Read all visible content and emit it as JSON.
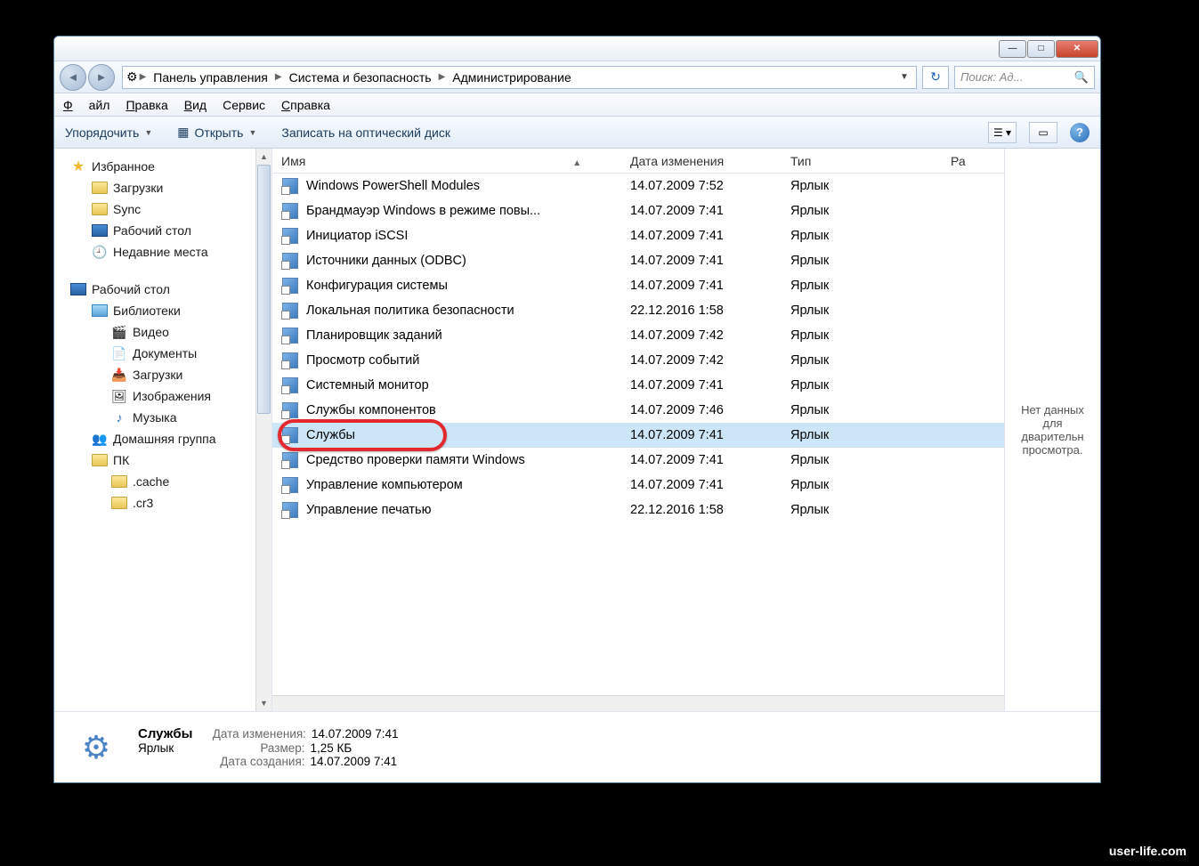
{
  "titlebar": {
    "min": "—",
    "max": "□",
    "close": "✕"
  },
  "breadcrumbs": [
    "Панель управления",
    "Система и безопасность",
    "Администрирование"
  ],
  "search_placeholder": "Поиск: Ад...",
  "menubar": {
    "file": "Файл",
    "edit": "Правка",
    "view": "Вид",
    "service": "Сервис",
    "help": "Справка"
  },
  "toolbar": {
    "organize": "Упорядочить",
    "open": "Открыть",
    "burn": "Записать на оптический диск"
  },
  "columns": {
    "name": "Имя",
    "date": "Дата изменения",
    "type": "Тип",
    "size": "Ра"
  },
  "sidebar": {
    "favorites": "Избранное",
    "fav_items": [
      "Загрузки",
      "Sync",
      "Рабочий стол",
      "Недавние места"
    ],
    "desktop": "Рабочий стол",
    "libraries": "Библиотеки",
    "lib_items": [
      "Видео",
      "Документы",
      "Загрузки",
      "Изображения",
      "Музыка"
    ],
    "homegroup": "Домашняя группа",
    "pc": "ПК",
    "pc_items": [
      ".cache",
      ".cr3"
    ]
  },
  "files": [
    {
      "name": "Windows PowerShell Modules",
      "date": "14.07.2009 7:52",
      "type": "Ярлык"
    },
    {
      "name": "Брандмауэр Windows в режиме повы...",
      "date": "14.07.2009 7:41",
      "type": "Ярлык"
    },
    {
      "name": "Инициатор iSCSI",
      "date": "14.07.2009 7:41",
      "type": "Ярлык"
    },
    {
      "name": "Источники данных (ODBC)",
      "date": "14.07.2009 7:41",
      "type": "Ярлык"
    },
    {
      "name": "Конфигурация системы",
      "date": "14.07.2009 7:41",
      "type": "Ярлык"
    },
    {
      "name": "Локальная политика безопасности",
      "date": "22.12.2016 1:58",
      "type": "Ярлык"
    },
    {
      "name": "Планировщик заданий",
      "date": "14.07.2009 7:42",
      "type": "Ярлык"
    },
    {
      "name": "Просмотр событий",
      "date": "14.07.2009 7:42",
      "type": "Ярлык"
    },
    {
      "name": "Системный монитор",
      "date": "14.07.2009 7:41",
      "type": "Ярлык"
    },
    {
      "name": "Службы компонентов",
      "date": "14.07.2009 7:46",
      "type": "Ярлык"
    },
    {
      "name": "Службы",
      "date": "14.07.2009 7:41",
      "type": "Ярлык",
      "selected": true
    },
    {
      "name": "Средство проверки памяти Windows",
      "date": "14.07.2009 7:41",
      "type": "Ярлык"
    },
    {
      "name": "Управление компьютером",
      "date": "14.07.2009 7:41",
      "type": "Ярлык"
    },
    {
      "name": "Управление печатью",
      "date": "22.12.2016 1:58",
      "type": "Ярлык"
    }
  ],
  "preview_text": "Нет данных для дварительн просмотра.",
  "details": {
    "title": "Службы",
    "subtitle": "Ярлык",
    "modified_label": "Дата изменения:",
    "modified": "14.07.2009 7:41",
    "size_label": "Размер:",
    "size": "1,25 КБ",
    "created_label": "Дата создания:",
    "created": "14.07.2009 7:41"
  },
  "watermark": "user-life.com"
}
